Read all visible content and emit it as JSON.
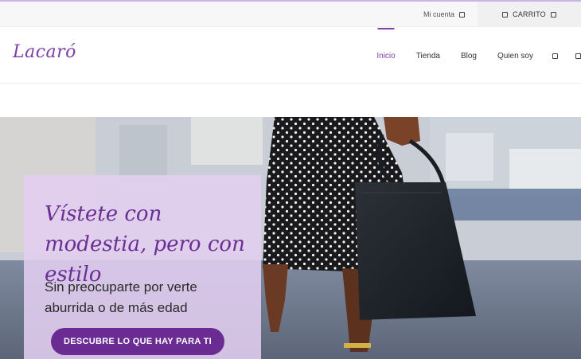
{
  "topbar": {
    "account_label": "Mi cuenta",
    "account_icon": "square-icon",
    "cart_label": "CARRITO",
    "cart_icon": "square-icon"
  },
  "header": {
    "logo_text": "Lacaró",
    "nav": [
      {
        "label": "Inicio",
        "active": true
      },
      {
        "label": "Tienda",
        "active": false
      },
      {
        "label": "Blog",
        "active": false
      },
      {
        "label": "Quien soy",
        "active": false
      }
    ],
    "nav_icons": [
      "square-icon",
      "square-icon"
    ]
  },
  "hero": {
    "title": "Vístete con modestia, pero con estilo",
    "subtitle": "Sin preocuparte por verte aburrida o de más edad",
    "cta_label": "DESCUBRE  LO QUE HAY PARA TI"
  },
  "colors": {
    "brand": "#7c3fa8",
    "cta_background": "#6a2c93",
    "promo_panel": "#e2cef0",
    "top_accent": "#c9b3ee"
  }
}
